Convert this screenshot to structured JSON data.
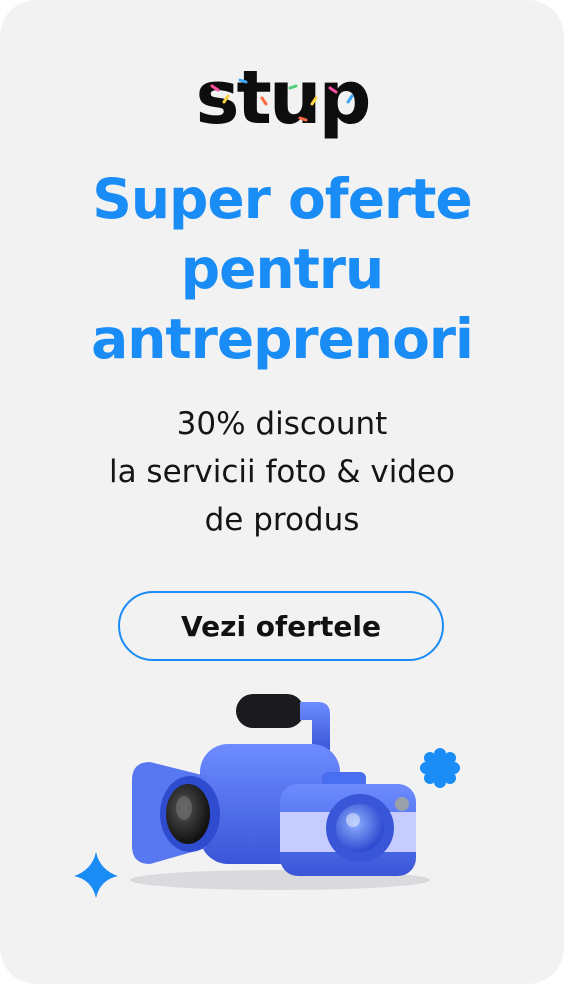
{
  "brand": {
    "logo_text": "stup"
  },
  "headline": {
    "lines": [
      "Super oferte",
      "pentru",
      "antreprenori"
    ]
  },
  "subtitle": {
    "lines": [
      "30% discount",
      "la servicii foto & video",
      "de produs"
    ]
  },
  "cta": {
    "label": "Vezi ofertele"
  },
  "icons": [
    "video-camera-icon",
    "photo-camera-icon",
    "sparkle-star-icon",
    "flower-badge-icon"
  ],
  "colors": {
    "accent": "#1a8cf5",
    "background": "#f2f2f2",
    "text": "#151515",
    "camera_blue": "#4a6ef0"
  }
}
